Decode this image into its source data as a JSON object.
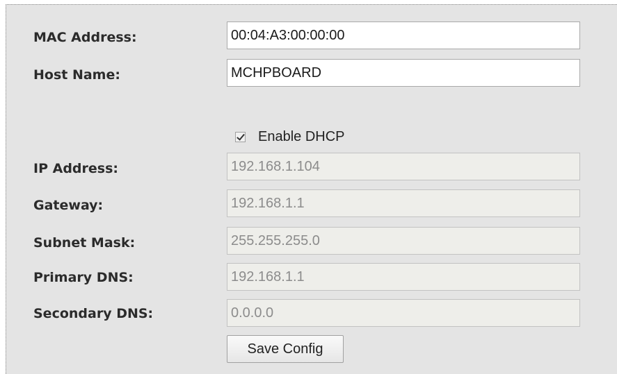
{
  "form": {
    "mac_label": "MAC Address:",
    "mac_value": "00:04:A3:00:00:00",
    "host_label": "Host Name:",
    "host_value": "MCHPBOARD",
    "dhcp_label": "Enable DHCP",
    "dhcp_checked": true,
    "ip_label": "IP Address:",
    "ip_value": "192.168.1.104",
    "gateway_label": "Gateway:",
    "gateway_value": "192.168.1.1",
    "subnet_label": "Subnet Mask:",
    "subnet_value": "255.255.255.0",
    "pdns_label": "Primary DNS:",
    "pdns_value": "192.168.1.1",
    "sdns_label": "Secondary DNS:",
    "sdns_value": "0.0.0.0",
    "save_label": "Save Config"
  }
}
